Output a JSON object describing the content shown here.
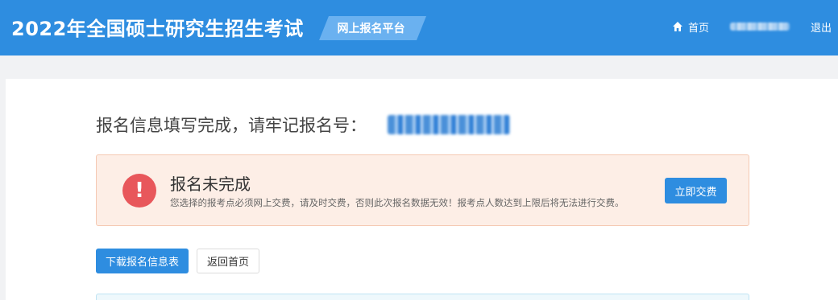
{
  "header": {
    "title": "2022年全国硕士研究生招生考试",
    "platform_label": "网上报名平台",
    "nav": {
      "home_label": "首页",
      "home_icon": "home-icon",
      "logout_label": "退出"
    }
  },
  "registration": {
    "label": "报名信息填写完成，请牢记报名号："
  },
  "alert": {
    "icon": "exclamation-icon",
    "title": "报名未完成",
    "description": "您选择的报考点必须网上交费，请及时交费，否则此次报名数据无效！报考点人数达到上限后将无法进行交费。",
    "pay_button_label": "立即交费"
  },
  "actions": {
    "download_label": "下载报名信息表",
    "return_home_label": "返回首页"
  },
  "colors": {
    "primary": "#2e8de0",
    "alert_bg": "#fdeee6",
    "alert_icon": "#e8575b"
  }
}
